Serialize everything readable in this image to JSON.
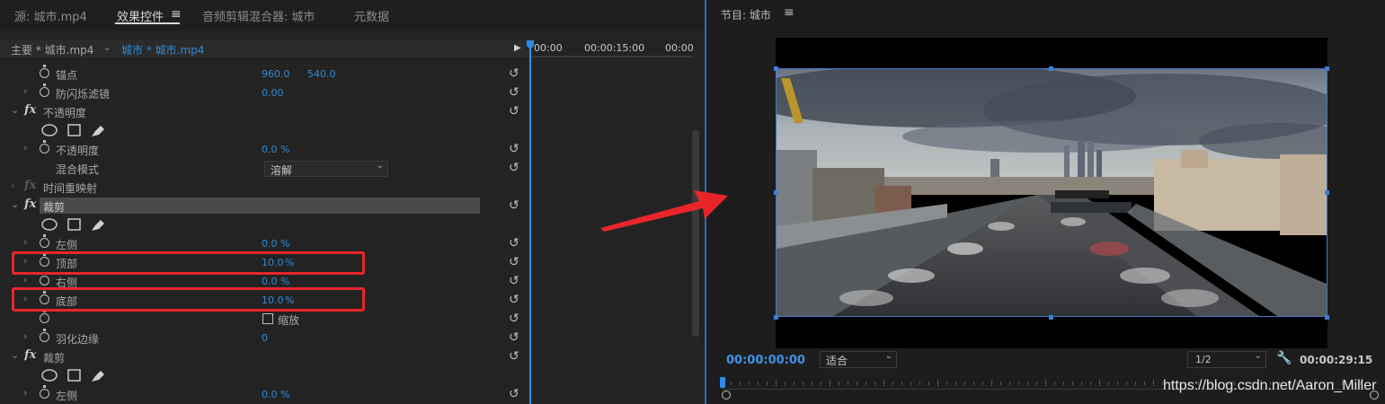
{
  "left_panel": {
    "tabs": [
      {
        "label": "源: 城市.mp4"
      },
      {
        "label": "效果控件"
      },
      {
        "label": "音频剪辑混合器: 城市"
      },
      {
        "label": "元数据"
      }
    ],
    "tab_menu_icon": "hamburger-icon",
    "clip_main": "主要 * 城市.mp4",
    "clip_sequence": "城市 * 城市.mp4",
    "timecodes": [
      "00:00",
      "00:00:15:00",
      "00:00"
    ],
    "properties": {
      "anchor": {
        "label": "锚点",
        "x": "960.0",
        "y": "540.0"
      },
      "anti_flicker": {
        "label": "防闪烁滤镜",
        "value": "0.00"
      },
      "opacity_fx": "不透明度",
      "opacity": {
        "label": "不透明度",
        "value": "0.0",
        "unit": "%"
      },
      "blend_mode": {
        "label": "混合模式",
        "value": "溶解"
      },
      "time_remap": "时间重映射",
      "crop1_fx": "裁剪",
      "left": {
        "label": "左侧",
        "value": "0.0",
        "unit": "%"
      },
      "top": {
        "label": "顶部",
        "value": "10.0",
        "unit": "%"
      },
      "right": {
        "label": "右侧",
        "value": "0.0",
        "unit": "%"
      },
      "bottom": {
        "label": "底部",
        "value": "10.0",
        "unit": "%"
      },
      "zoom": {
        "label": "缩放"
      },
      "feather": {
        "label": "羽化边缘",
        "value": "0"
      },
      "crop2_fx": "裁剪",
      "left2": {
        "label": "左侧",
        "value": "0.0",
        "unit": "%"
      }
    }
  },
  "right_panel": {
    "title": "节目: 城市",
    "menu_icon": "hamburger-icon",
    "current_time": "00:00:00:00",
    "fit_label": "适合",
    "resolution": "1/2",
    "duration": "00:00:29:15",
    "watermark": "https://blog.csdn.net/Aaron_Miller"
  },
  "colors": {
    "accent_blue": "#2f8bd9",
    "highlight_red": "#e8262a"
  }
}
